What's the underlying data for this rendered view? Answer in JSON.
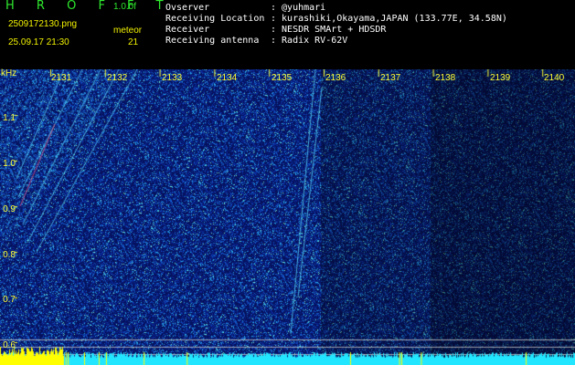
{
  "header": {
    "brand": "H R O F F T",
    "version": "1.0.0f",
    "filename": "2509172130.png",
    "datetime": "25.09.17 21:30",
    "meteor_label": "meteor",
    "meteor_count": "21",
    "info_labels": [
      "Ovserver",
      "Receiving Location",
      "Receiver",
      "Receiving antenna"
    ],
    "info_values": [
      ": @yuhmari",
      ": kurashiki,Okayama,JAPAN (133.77E, 34.58N)",
      ": NESDR SMArt + HDSDR",
      ": Radix RV-62V"
    ]
  },
  "axes": {
    "y_unit": "kHz",
    "y_ticks": [
      "1.1",
      "1.0",
      "0.9",
      "0.8",
      "0.7",
      "0.6"
    ],
    "x_ticks": [
      "2131",
      "2132",
      "2133",
      "2134",
      "2135",
      "2136",
      "2137",
      "2138",
      "2139",
      "2140"
    ]
  },
  "colors": {
    "label_green": "#2ee82e",
    "label_yellow": "#f2f200",
    "spectrum_bg": "#0a1a7a",
    "baseline_cyan": "#22e6ff",
    "baseline_yellow": "#ffff00"
  }
}
